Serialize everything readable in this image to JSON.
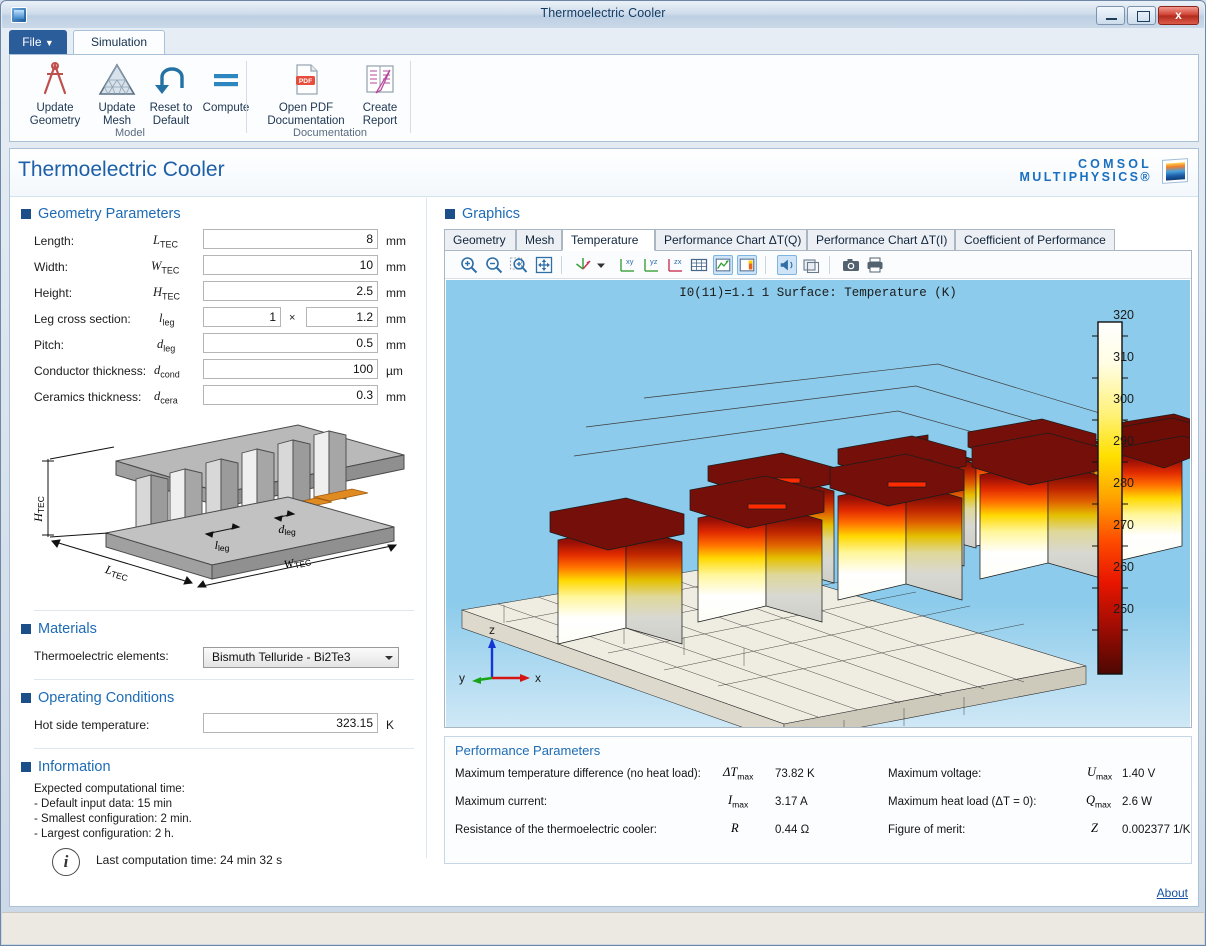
{
  "window": {
    "title": "Thermoelectric Cooler",
    "icon": "app-icon",
    "minimize": "minimize",
    "maximize": "maximize",
    "close": "x"
  },
  "ribbon": {
    "file_tab": "File",
    "sim_tab": "Simulation",
    "groups": [
      {
        "label": "Model"
      },
      {
        "label": "Documentation"
      }
    ],
    "buttons": [
      {
        "name": "update-geometry",
        "line1": "Update",
        "line2": "Geometry",
        "icon": "compass-icon"
      },
      {
        "name": "update-mesh",
        "line1": "Update",
        "line2": "Mesh",
        "icon": "mesh-triangle-icon"
      },
      {
        "name": "reset-to-default",
        "line1": "Reset to",
        "line2": "Default",
        "icon": "undo-arrow-icon"
      },
      {
        "name": "compute",
        "line1": "Compute",
        "line2": "",
        "icon": "equals-icon"
      },
      {
        "name": "open-pdf-documentation",
        "line1": "Open PDF",
        "line2": "Documentation",
        "icon": "pdf-icon"
      },
      {
        "name": "create-report",
        "line1": "Create",
        "line2": "Report",
        "icon": "report-pen-icon"
      }
    ]
  },
  "header": {
    "app_title": "Thermoelectric Cooler",
    "brand_line1": "COMSOL",
    "brand_line2": "MULTIPHYSICS®"
  },
  "geometry": {
    "section_title": "Geometry Parameters",
    "rows": [
      {
        "label": "Length:",
        "sym": "L",
        "sub": "TEC",
        "value": "8",
        "unit": "mm"
      },
      {
        "label": "Width:",
        "sym": "W",
        "sub": "TEC",
        "value": "10",
        "unit": "mm"
      },
      {
        "label": "Height:",
        "sym": "H",
        "sub": "TEC",
        "value": "2.5",
        "unit": "mm"
      },
      {
        "label": "Leg cross section:",
        "sym": "l",
        "sub": "leg",
        "value": "1",
        "value2": "1.2",
        "sep": "×",
        "unit": "mm"
      },
      {
        "label": "Pitch:",
        "sym": "d",
        "sub": "leg",
        "value": "0.5",
        "unit": "mm"
      },
      {
        "label": "Conductor thickness:",
        "sym": "d",
        "sub": "cond",
        "value": "100",
        "unit": "µm"
      },
      {
        "label": "Ceramics thickness:",
        "sym": "d",
        "sub": "cera",
        "value": "0.3",
        "unit": "mm"
      }
    ],
    "schematic_labels": {
      "height": "H",
      "height_sub": "TEC",
      "length": "L",
      "length_sub": "TEC",
      "width": "W",
      "width_sub": "TEC",
      "leg": "l",
      "leg_sub": "leg",
      "pitch": "d",
      "pitch_sub": "leg"
    }
  },
  "materials": {
    "section_title": "Materials",
    "label": "Thermoelectric elements:",
    "selected": "Bismuth Telluride - Bi2Te3"
  },
  "operating": {
    "section_title": "Operating Conditions",
    "label": "Hot side temperature:",
    "value": "323.15",
    "unit": "K"
  },
  "information": {
    "section_title": "Information",
    "lines": [
      "Expected computational time:",
      " - Default input data: 15 min",
      " - Smallest configuration: 2 min.",
      " - Largest configuration: 2 h."
    ],
    "icon": "info-icon",
    "last_computation": "Last computation time: 24 min 32 s"
  },
  "graphics": {
    "section_title": "Graphics",
    "tabs": [
      {
        "label": "Geometry",
        "active": false
      },
      {
        "label": "Mesh",
        "active": false
      },
      {
        "label": "Temperature",
        "active": true
      },
      {
        "label": "Performance Chart ΔT(Q)",
        "active": false
      },
      {
        "label": "Performance Chart ΔT(I)",
        "active": false
      },
      {
        "label": "Coefficient of Performance",
        "active": false
      }
    ],
    "toolbar": [
      "zoom-in-icon",
      "zoom-out-icon",
      "zoom-box-icon",
      "zoom-extents-icon",
      "rotate-axis-icon",
      "dropdown-arrow-icon",
      "view-xy-icon",
      "view-yz-icon",
      "view-zx-icon",
      "grid-icon",
      "plot-toggle-icon",
      "colorbar-icon",
      "scene-light-icon",
      "transparency-icon",
      "camera-snapshot-icon",
      "print-icon"
    ],
    "plot_title": "I0(11)=1.1 1   Surface: Temperature (K)",
    "axes": {
      "x": "x",
      "y": "y",
      "z": "z"
    }
  },
  "chart_data": {
    "type": "heatmap",
    "title": "I0(11)=1.1 1   Surface: Temperature (K)",
    "colorbar_label": "Temperature (K)",
    "ticks": [
      320,
      310,
      300,
      290,
      280,
      270,
      260,
      250
    ],
    "range": [
      245,
      325
    ],
    "colormap": [
      "#5c0a05",
      "#b51308",
      "#f03000",
      "#ff8a00",
      "#ffe000",
      "#fff7a0",
      "#ffffff"
    ],
    "xlabel": "x",
    "ylabel": "y",
    "zlabel": "z",
    "grid": false,
    "legend": "right"
  },
  "performance": {
    "title": "Performance Parameters",
    "left": [
      {
        "label": "Maximum temperature difference (no heat load):",
        "sym": "ΔT",
        "sub": "max",
        "value": "73.82 K"
      },
      {
        "label": "Maximum current:",
        "sym": "I",
        "sub": "max",
        "value": "3.17 A"
      },
      {
        "label": "Resistance of the thermoelectric cooler:",
        "sym": "R",
        "sub": "",
        "value": "0.44 Ω"
      }
    ],
    "right": [
      {
        "label": "Maximum voltage:",
        "sym": "U",
        "sub": "max",
        "value": "1.40 V"
      },
      {
        "label": "Maximum heat load (ΔT = 0):",
        "sym": "Q",
        "sub": "max",
        "value": "2.6 W"
      },
      {
        "label": "Figure of merit:",
        "sym": "Z",
        "sub": "",
        "value": "0.002377 1/K"
      }
    ]
  },
  "footer": {
    "about": "About"
  },
  "colors": {
    "accent_blue": "#1d6bb5",
    "bullet_blue": "#1c4f8a",
    "file_tab": "#2c5d9b",
    "link": "#1352a0",
    "plot_bg": "#8ccbeb"
  }
}
